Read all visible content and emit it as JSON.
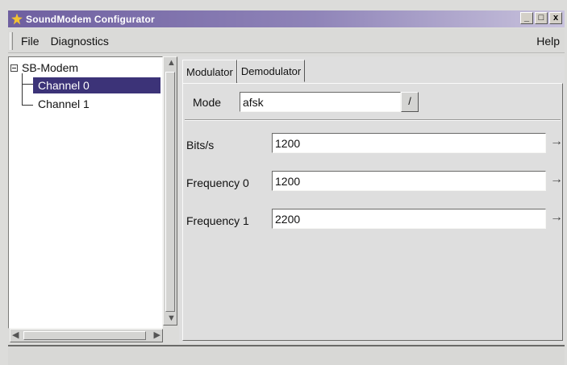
{
  "window": {
    "title": "SoundModem Configurator",
    "controls": {
      "minimize": "_",
      "maximize": "□",
      "close": "x"
    }
  },
  "menu": {
    "items": [
      "File",
      "Diagnostics"
    ],
    "help": "Help"
  },
  "tree": {
    "root": {
      "label": "SB-Modem",
      "expander": "−"
    },
    "children": [
      {
        "label": "Channel 0",
        "selected": true
      },
      {
        "label": "Channel 1",
        "selected": false
      }
    ]
  },
  "tabs": [
    {
      "label": "Modulator",
      "active": true
    },
    {
      "label": "Demodulator",
      "active": false
    }
  ],
  "modulator": {
    "mode": {
      "label": "Mode",
      "value": "afsk",
      "button_glyph": "/"
    },
    "fields": [
      {
        "label": "Bits/s",
        "value": "1200",
        "spin_glyph": "→"
      },
      {
        "label": "Frequency 0",
        "value": "1200",
        "spin_glyph": "→"
      },
      {
        "label": "Frequency 1",
        "value": "2200",
        "spin_glyph": "→"
      }
    ]
  },
  "colors": {
    "title_gradient_start": "#6e5fa0",
    "selection": "#3c3378"
  }
}
